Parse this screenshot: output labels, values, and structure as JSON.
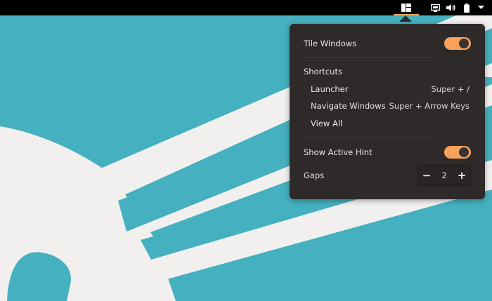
{
  "topbar": {
    "tile_icon": "tile-windows-icon",
    "status_icons": [
      "display-icon",
      "volume-icon",
      "battery-icon",
      "menu-arrow-icon"
    ]
  },
  "menu": {
    "tile_windows_label": "Tile Windows",
    "tile_windows_on": true,
    "shortcuts_heading": "Shortcuts",
    "shortcuts": [
      {
        "label": "Launcher",
        "accel": "Super + /"
      },
      {
        "label": "Navigate Windows",
        "accel": "Super + Arrow Keys"
      },
      {
        "label": "View All",
        "accel": ""
      }
    ],
    "show_active_hint_label": "Show Active Hint",
    "show_active_hint_on": true,
    "gaps_label": "Gaps",
    "gaps_value": "2",
    "gaps_minus": "−",
    "gaps_plus": "+"
  },
  "colors": {
    "accent": "#f6a25a",
    "popover_bg": "#2f2a2a",
    "wallpaper_teal": "#45b0bf",
    "wallpaper_white": "#f1f0ee"
  }
}
